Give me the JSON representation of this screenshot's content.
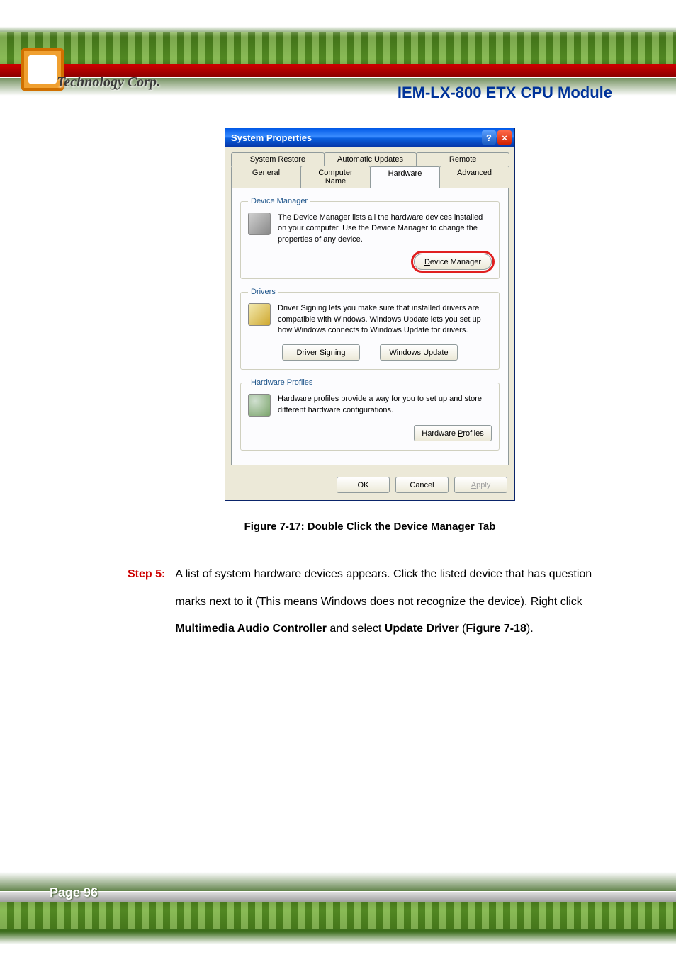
{
  "header": {
    "brand": "Technology Corp.",
    "doc_title": "IEM-LX-800  ETX  CPU  Module"
  },
  "dialog": {
    "title": "System Properties",
    "help_icon": "?",
    "close_icon": "×",
    "tabs_row1": [
      "System Restore",
      "Automatic Updates",
      "Remote"
    ],
    "tabs_row2": [
      "General",
      "Computer Name",
      "Hardware",
      "Advanced"
    ],
    "active_tab": "Hardware",
    "sections": {
      "device_manager": {
        "legend": "Device Manager",
        "text": "The Device Manager lists all the hardware devices installed on your computer. Use the Device Manager to change the properties of any device.",
        "button": "Device Manager"
      },
      "drivers": {
        "legend": "Drivers",
        "text": "Driver Signing lets you make sure that installed drivers are compatible with Windows. Windows Update lets you set up how Windows connects to Windows Update for drivers.",
        "button_signing": "Driver Signing",
        "button_update": "Windows Update"
      },
      "hardware_profiles": {
        "legend": "Hardware Profiles",
        "text": "Hardware profiles provide a way for you to set up and store different hardware configurations.",
        "button": "Hardware Profiles"
      }
    },
    "footer": {
      "ok": "OK",
      "cancel": "Cancel",
      "apply": "Apply"
    }
  },
  "figure_caption": "Figure 7-17: Double Click the Device Manager Tab",
  "step": {
    "label": "Step 5:",
    "text_parts": {
      "p1": "A list of system hardware devices appears. Click the listed device that has question marks next to it (This means Windows does not recognize the device). Right click ",
      "b1": "Multimedia Audio Controller",
      "p2": " and select ",
      "b2": "Update Driver",
      "p3": " (",
      "b3": "Figure 7-18",
      "p4": ")."
    }
  },
  "footer": {
    "page": "Page 96"
  }
}
